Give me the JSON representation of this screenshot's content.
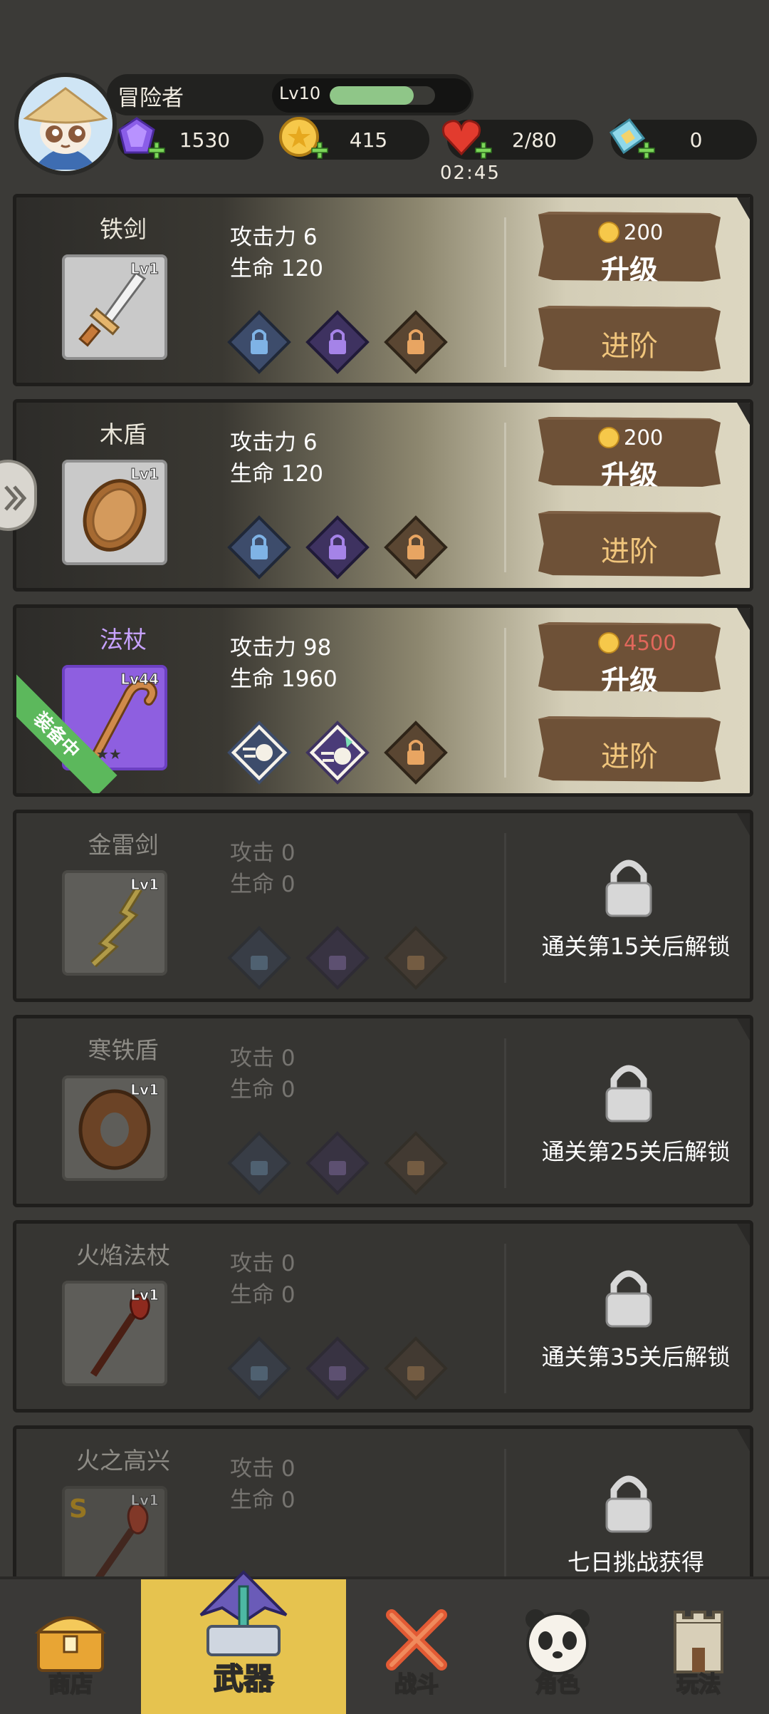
{
  "player": {
    "name": "冒险者",
    "level": "Lv10",
    "xp_fraction": 0.8
  },
  "resources": {
    "gems": "1530",
    "gold": "415",
    "stamina": "2/80",
    "stamina_timer": "02:45",
    "tickets": "0"
  },
  "weapons": [
    {
      "name": "铁剑",
      "level": "Lv1",
      "stat1": "攻击力 6",
      "stat2": "生命 120",
      "upgrade_cost": "200",
      "upgrade_label": "升级",
      "advance_label": "进阶"
    },
    {
      "name": "木盾",
      "level": "Lv1",
      "stat1": "攻击力 6",
      "stat2": "生命 120",
      "upgrade_cost": "200",
      "upgrade_label": "升级",
      "advance_label": "进阶"
    },
    {
      "name": "法杖",
      "level": "Lv44",
      "stat1": "攻击力 98",
      "stat2": "生命 1960",
      "upgrade_cost": "4500",
      "upgrade_label": "升级",
      "advance_label": "进阶",
      "equipped_label": "装备中"
    },
    {
      "name": "金雷剑",
      "level": "Lv1",
      "stat1": "攻击 0",
      "stat2": "生命 0",
      "unlock_text": "通关第15关后解锁"
    },
    {
      "name": "寒铁盾",
      "level": "Lv1",
      "stat1": "攻击 0",
      "stat2": "生命 0",
      "unlock_text": "通关第25关后解锁"
    },
    {
      "name": "火焰法杖",
      "level": "Lv1",
      "stat1": "攻击 0",
      "stat2": "生命 0",
      "unlock_text": "通关第35关后解锁"
    },
    {
      "name": "火之高兴",
      "level": "Lv1",
      "stat1": "攻击 0",
      "stat2": "生命 0",
      "unlock_text": "七日挑战获得",
      "rarity_badge": "S"
    }
  ],
  "nav": [
    {
      "label": "商店",
      "icon": "treasure-chest-icon"
    },
    {
      "label": "武器",
      "icon": "weapon-altar-icon",
      "active": true
    },
    {
      "label": "战斗",
      "icon": "crossed-swords-icon"
    },
    {
      "label": "角色",
      "icon": "panda-icon"
    },
    {
      "label": "玩法",
      "icon": "castle-tower-icon"
    }
  ],
  "colors": {
    "accent": "#e6c34f",
    "equipped": "#5cb85c",
    "insufficient": "#e0675b",
    "xp": "#8fc688"
  }
}
